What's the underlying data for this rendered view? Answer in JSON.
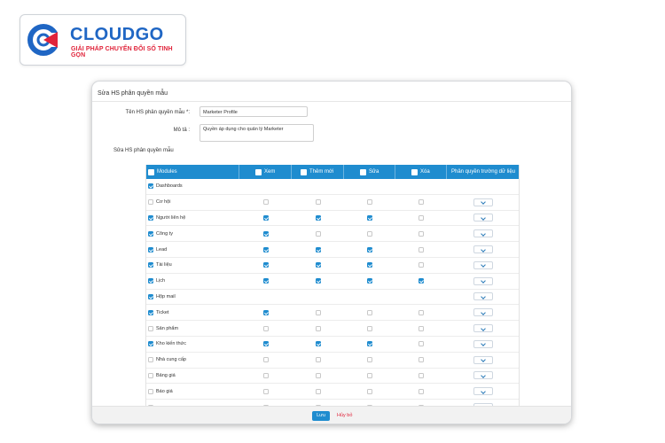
{
  "brand": {
    "name": "CLOUDGO",
    "tagline": "GIẢI PHÁP CHUYỂN ĐỔI SỐ TINH GỌN",
    "colors": {
      "blue": "#1f66c4",
      "red": "#e0243b"
    }
  },
  "form": {
    "title": "Sửa HS phân quyền mẫu",
    "name_label": "Tên HS phân quyền mẫu *:",
    "name_value": "Marketer Profile",
    "desc_label": "Mô tả :",
    "desc_value": "Quyền áp dụng cho quản lý Marketer",
    "section_label": "Sửa HS phân quyền mẫu"
  },
  "table": {
    "header_color": "#1f8ccf",
    "headers": {
      "modules": "Modules",
      "view": "Xem",
      "add": "Thêm mới",
      "edit": "Sửa",
      "delete": "Xóa",
      "field_perm": "Phân quyền trường dữ liệu"
    },
    "rows": [
      {
        "module": "Dashboards",
        "enabled": true,
        "view": null,
        "add": null,
        "edit": null,
        "del": null,
        "dropdown": false
      },
      {
        "module": "Cơ hội",
        "enabled": false,
        "view": false,
        "add": false,
        "edit": false,
        "del": false,
        "dropdown": true
      },
      {
        "module": "Người liên hệ",
        "enabled": true,
        "view": true,
        "add": true,
        "edit": true,
        "del": false,
        "dropdown": true
      },
      {
        "module": "Công ty",
        "enabled": true,
        "view": true,
        "add": false,
        "edit": false,
        "del": false,
        "dropdown": true
      },
      {
        "module": "Lead",
        "enabled": true,
        "view": true,
        "add": true,
        "edit": true,
        "del": false,
        "dropdown": true
      },
      {
        "module": "Tài liệu",
        "enabled": true,
        "view": true,
        "add": true,
        "edit": true,
        "del": false,
        "dropdown": true
      },
      {
        "module": "Lịch",
        "enabled": true,
        "view": true,
        "add": true,
        "edit": true,
        "del": true,
        "dropdown": true
      },
      {
        "module": "Hộp mail",
        "enabled": true,
        "view": null,
        "add": null,
        "edit": null,
        "del": null,
        "dropdown": true
      },
      {
        "module": "Ticket",
        "enabled": true,
        "view": true,
        "add": false,
        "edit": false,
        "del": false,
        "dropdown": true
      },
      {
        "module": "Sản phẩm",
        "enabled": false,
        "view": false,
        "add": false,
        "edit": false,
        "del": false,
        "dropdown": true
      },
      {
        "module": "Kho kiến thức",
        "enabled": true,
        "view": true,
        "add": true,
        "edit": true,
        "del": false,
        "dropdown": true
      },
      {
        "module": "Nhà cung cấp",
        "enabled": false,
        "view": false,
        "add": false,
        "edit": false,
        "del": false,
        "dropdown": true
      },
      {
        "module": "Bảng giá",
        "enabled": false,
        "view": false,
        "add": false,
        "edit": false,
        "del": false,
        "dropdown": true
      },
      {
        "module": "Báo giá",
        "enabled": false,
        "view": false,
        "add": false,
        "edit": false,
        "del": false,
        "dropdown": true
      },
      {
        "module": "",
        "enabled": false,
        "view": false,
        "add": false,
        "edit": false,
        "del": false,
        "dropdown": true
      }
    ]
  },
  "footer": {
    "save_label": "Lưu",
    "cancel_label": "Hủy bỏ"
  }
}
